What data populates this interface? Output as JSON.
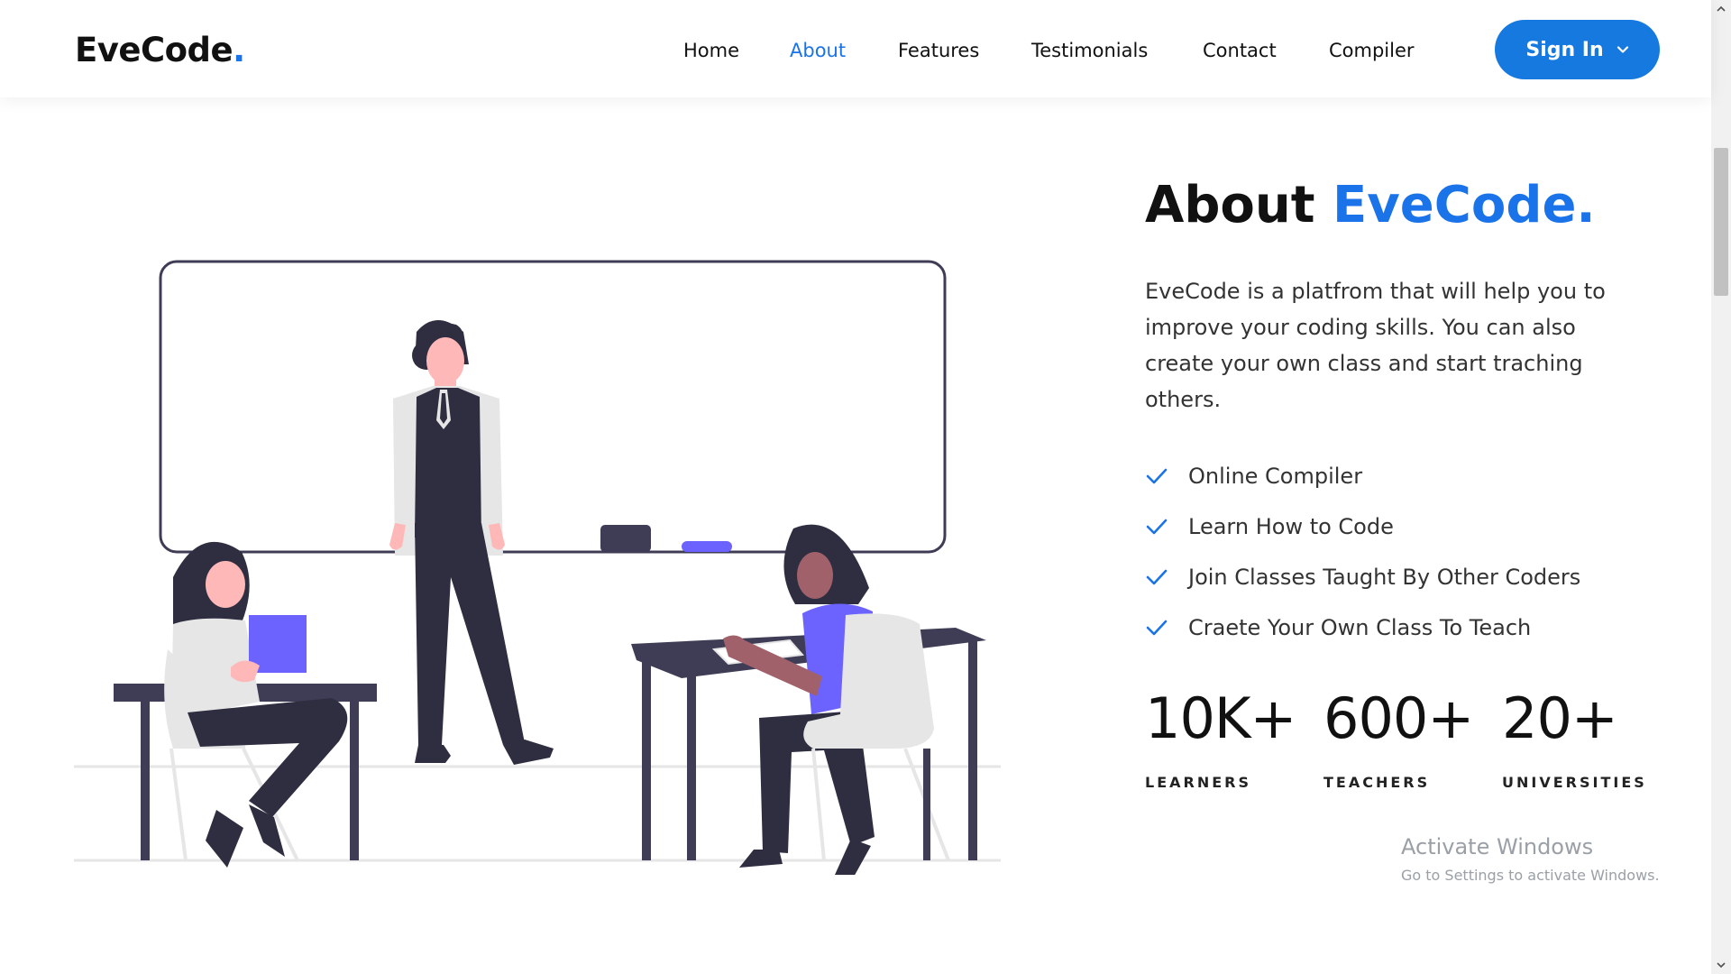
{
  "header": {
    "logo_text": "EveCode",
    "logo_dot": ".",
    "nav": [
      {
        "label": "Home",
        "active": false
      },
      {
        "label": "About",
        "active": true
      },
      {
        "label": "Features",
        "active": false
      },
      {
        "label": "Testimonials",
        "active": false
      },
      {
        "label": "Contact",
        "active": false
      },
      {
        "label": "Compiler",
        "active": false
      }
    ],
    "signin_label": "Sign In"
  },
  "about": {
    "heading_prefix": "About",
    "heading_brand": "EveCode.",
    "description": "EveCode is a platfrom that will help you to improve your coding skills. You can also create your own class and start traching others.",
    "features": [
      "Online Compiler",
      "Learn How to Code",
      "Join Classes Taught By Other Coders",
      "Craete Your Own Class To Teach"
    ],
    "stats": [
      {
        "number": "10K+",
        "label": "LEARNERS"
      },
      {
        "number": "600+",
        "label": "TEACHERS"
      },
      {
        "number": "20+",
        "label": "UNIVERSITIES"
      }
    ]
  },
  "watermark": {
    "line1": "Activate Windows",
    "line2": "Go to Settings to activate Windows."
  },
  "colors": {
    "accent": "#1a73e8",
    "button": "#1679e0",
    "illustration_dark": "#3f3d56",
    "illustration_purple": "#6c63ff",
    "illustration_light": "#e6e6e6"
  }
}
